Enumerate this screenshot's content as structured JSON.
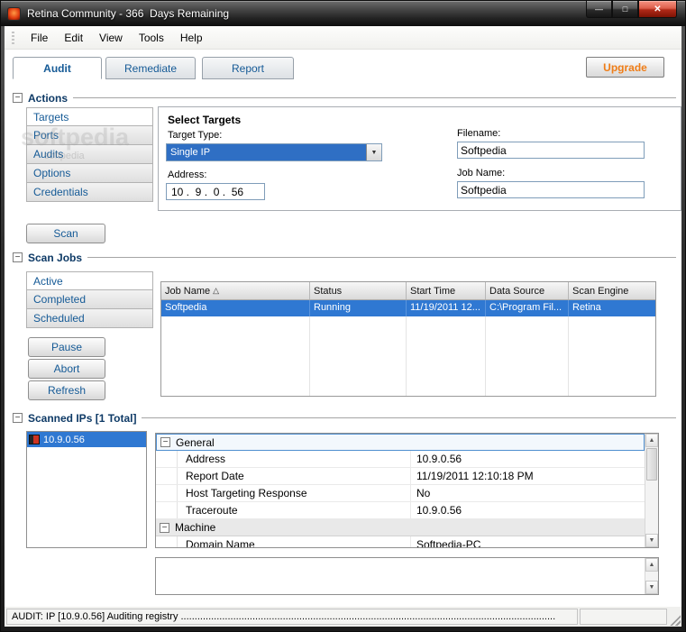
{
  "window": {
    "title": "Retina Community - 366  Days Remaining",
    "status_text": "AUDIT: IP [10.9.0.56] Auditing registry ........................................................................................................................................"
  },
  "colors": {
    "selection_blue": "#2f78d2",
    "link_blue": "#155a96",
    "upgrade_orange": "#ef7d17",
    "header_navy": "#0e3a66"
  },
  "icons": {
    "minimize": "—",
    "maximize": "□",
    "close": "✕",
    "collapse": "−",
    "dropdown": "▼",
    "scroll_up": "▲",
    "scroll_down": "▼",
    "sort_asc": "△"
  },
  "menu": {
    "items": [
      "File",
      "Edit",
      "View",
      "Tools",
      "Help"
    ]
  },
  "tabs": {
    "items": [
      "Audit",
      "Remediate",
      "Report"
    ],
    "upgrade_label": "Upgrade"
  },
  "actions": {
    "header": "Actions",
    "sidebar": [
      "Targets",
      "Ports",
      "Audits",
      "Options",
      "Credentials"
    ],
    "scan_button": "Scan",
    "select_targets": {
      "title": "Select Targets",
      "target_type_label": "Target Type:",
      "target_type_value": "Single IP",
      "address_label": "Address:",
      "address_value": "10 .  9 .  0 .  56",
      "filename_label": "Filename:",
      "filename_value": "Softpedia",
      "job_name_label": "Job Name:",
      "job_name_value": "Softpedia"
    }
  },
  "scan_jobs": {
    "header": "Scan Jobs",
    "sidebar": [
      "Active",
      "Completed",
      "Scheduled"
    ],
    "buttons": [
      "Pause",
      "Abort",
      "Refresh"
    ],
    "table": {
      "columns": [
        "Job Name",
        "Status",
        "Start Time",
        "Data Source",
        "Scan Engine"
      ],
      "rows": [
        [
          "Softpedia",
          "Running",
          "11/19/2011 12...",
          "C:\\Program Fil...",
          "Retina"
        ]
      ]
    }
  },
  "scanned_ips": {
    "header": "Scanned IPs [1 Total]",
    "list": [
      "10.9.0.56"
    ],
    "properties": [
      {
        "label": "General"
      },
      {
        "label": "Address",
        "value": "10.9.0.56"
      },
      {
        "label": "Report Date",
        "value": "11/19/2011 12:10:18 PM"
      },
      {
        "label": "Host Targeting Response",
        "value": "No"
      },
      {
        "label": "Traceroute",
        "value": "10.9.0.56"
      },
      {
        "label": "Machine"
      },
      {
        "label": "Domain Name",
        "value": "Softpedia-PC"
      }
    ]
  },
  "watermark": {
    "big": "softpedia",
    "small": "softpedia"
  }
}
